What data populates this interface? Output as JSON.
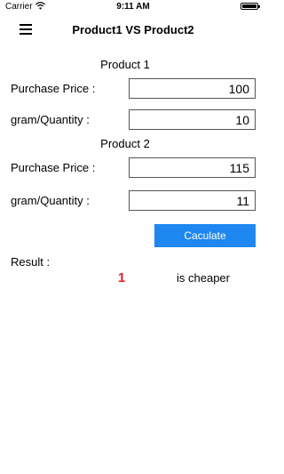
{
  "status_bar": {
    "carrier": "Carrier",
    "time": "9:11 AM"
  },
  "nav": {
    "title": "Product1 VS Product2"
  },
  "product1": {
    "title": "Product 1",
    "price_label": "Purchase Price :",
    "price_value": "100",
    "quantity_label": "gram/Quantity :",
    "quantity_value": "10"
  },
  "product2": {
    "title": "Product 2",
    "price_label": "Purchase Price :",
    "price_value": "115",
    "quantity_label": "gram/Quantity :",
    "quantity_value": "11"
  },
  "calculate_button": {
    "label": "Caculate",
    "color": "#1e87f0"
  },
  "result": {
    "label": "Result :",
    "value": "1",
    "value_color": "#e02020",
    "suffix": "is cheaper"
  },
  "icons": {
    "menu": "hamburger-icon",
    "wifi": "wifi-icon",
    "battery": "battery-icon"
  }
}
